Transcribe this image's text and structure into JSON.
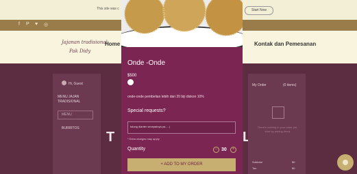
{
  "notice": {
    "text": "This site was c",
    "button": "Start Now"
  },
  "social": {
    "icons": [
      "facebook-icon",
      "pinterest-icon",
      "twitter-icon",
      "instagram-icon"
    ],
    "glyphs": [
      "f",
      "P",
      "♥",
      "◎"
    ]
  },
  "header": {
    "logo_line1": "Jajanan tradisional",
    "logo_line2": "Pak Didy",
    "nav_home": "Home",
    "nav_contact": "Kontak dan Pemesanan"
  },
  "sidebar": {
    "guest": "Hi, Guest",
    "menu_title": "MENU JAJAN TRADISIONAL",
    "menu_item": "MENU",
    "burritos": "BURRITOS"
  },
  "background_text": {
    "left": "T",
    "right": "L"
  },
  "order": {
    "title": "My Order",
    "items": "(0 items)",
    "empty_text": "There’s nothing in your order yet, start by adding items",
    "subtotal_label": "Subtotal",
    "subtotal_value": "$0",
    "tax_label": "Tax",
    "tax_value": "$0"
  },
  "modal": {
    "title": "Onde -Onde",
    "price": "$500",
    "description": "onde-onde pembelian lebih dari 20 biji diskon 10%",
    "special_label": "Special requests?",
    "special_value": "tolong dianter secepatnya ya.....|",
    "extra_note": "* Extra charges may apply",
    "quantity_label": "Quantity",
    "quantity_value": "30",
    "minus": "−",
    "plus": "+",
    "add_button": "+ ADD TO MY ORDER"
  },
  "colors": {
    "accent": "#c7ae71",
    "modal_bg": "#7b2652",
    "page_bg": "#5c2c40"
  }
}
